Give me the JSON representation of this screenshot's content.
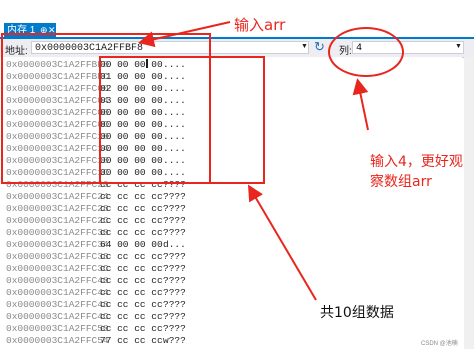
{
  "tab": {
    "title": "内存 1",
    "pin": "⊕",
    "close": "✕"
  },
  "toolbar": {
    "address_label": "地址:",
    "address_value": "0x0000003C1A2FFBF8",
    "columns_label": "列:",
    "columns_value": "4"
  },
  "memory_rows": [
    {
      "addr": "0x0000003C1A2FFBF8",
      "hex": "00 00 00 00",
      "text": "...."
    },
    {
      "addr": "0x0000003C1A2FFBFC",
      "hex": "01 00 00 00",
      "text": "...."
    },
    {
      "addr": "0x0000003C1A2FFC00",
      "hex": "02 00 00 00",
      "text": "...."
    },
    {
      "addr": "0x0000003C1A2FFC04",
      "hex": "03 00 00 00",
      "text": "...."
    },
    {
      "addr": "0x0000003C1A2FFC08",
      "hex": "00 00 00 00",
      "text": "...."
    },
    {
      "addr": "0x0000003C1A2FFC0C",
      "hex": "00 00 00 00",
      "text": "...."
    },
    {
      "addr": "0x0000003C1A2FFC10",
      "hex": "00 00 00 00",
      "text": "...."
    },
    {
      "addr": "0x0000003C1A2FFC14",
      "hex": "00 00 00 00",
      "text": "...."
    },
    {
      "addr": "0x0000003C1A2FFC18",
      "hex": "00 00 00 00",
      "text": "...."
    },
    {
      "addr": "0x0000003C1A2FFC1C",
      "hex": "00 00 00 00",
      "text": "...."
    },
    {
      "addr": "0x0000003C1A2FFC20",
      "hex": "cc cc cc cc",
      "text": "????"
    },
    {
      "addr": "0x0000003C1A2FFC24",
      "hex": "cc cc cc cc",
      "text": "????"
    },
    {
      "addr": "0x0000003C1A2FFC28",
      "hex": "cc cc cc cc",
      "text": "????"
    },
    {
      "addr": "0x0000003C1A2FFC2C",
      "hex": "cc cc cc cc",
      "text": "????"
    },
    {
      "addr": "0x0000003C1A2FFC30",
      "hex": "cc cc cc cc",
      "text": "????"
    },
    {
      "addr": "0x0000003C1A2FFC34",
      "hex": "64 00 00 00",
      "text": "d..."
    },
    {
      "addr": "0x0000003C1A2FFC38",
      "hex": "cc cc cc cc",
      "text": "????"
    },
    {
      "addr": "0x0000003C1A2FFC3C",
      "hex": "cc cc cc cc",
      "text": "????"
    },
    {
      "addr": "0x0000003C1A2FFC40",
      "hex": "cc cc cc cc",
      "text": "????"
    },
    {
      "addr": "0x0000003C1A2FFC44",
      "hex": "cc cc cc cc",
      "text": "????"
    },
    {
      "addr": "0x0000003C1A2FFC48",
      "hex": "cc cc cc cc",
      "text": "????"
    },
    {
      "addr": "0x0000003C1A2FFC4C",
      "hex": "cc cc cc cc",
      "text": "????"
    },
    {
      "addr": "0x0000003C1A2FFC50",
      "hex": "cc cc cc cc",
      "text": "????"
    },
    {
      "addr": "0x0000003C1A2FFC54",
      "hex": "77 cc cc cc",
      "text": "w???"
    }
  ],
  "annotations": {
    "input_arr": "输入arr",
    "input_4_line1": "输入4，更好观",
    "input_4_line2": "察数组arr",
    "ten_groups": "共10组数据"
  },
  "watermark": "CSDN @池楠",
  "colors": {
    "annotation_red": "#e8261e",
    "tab_blue": "#007acc",
    "address_gray": "#8a8a8a"
  }
}
